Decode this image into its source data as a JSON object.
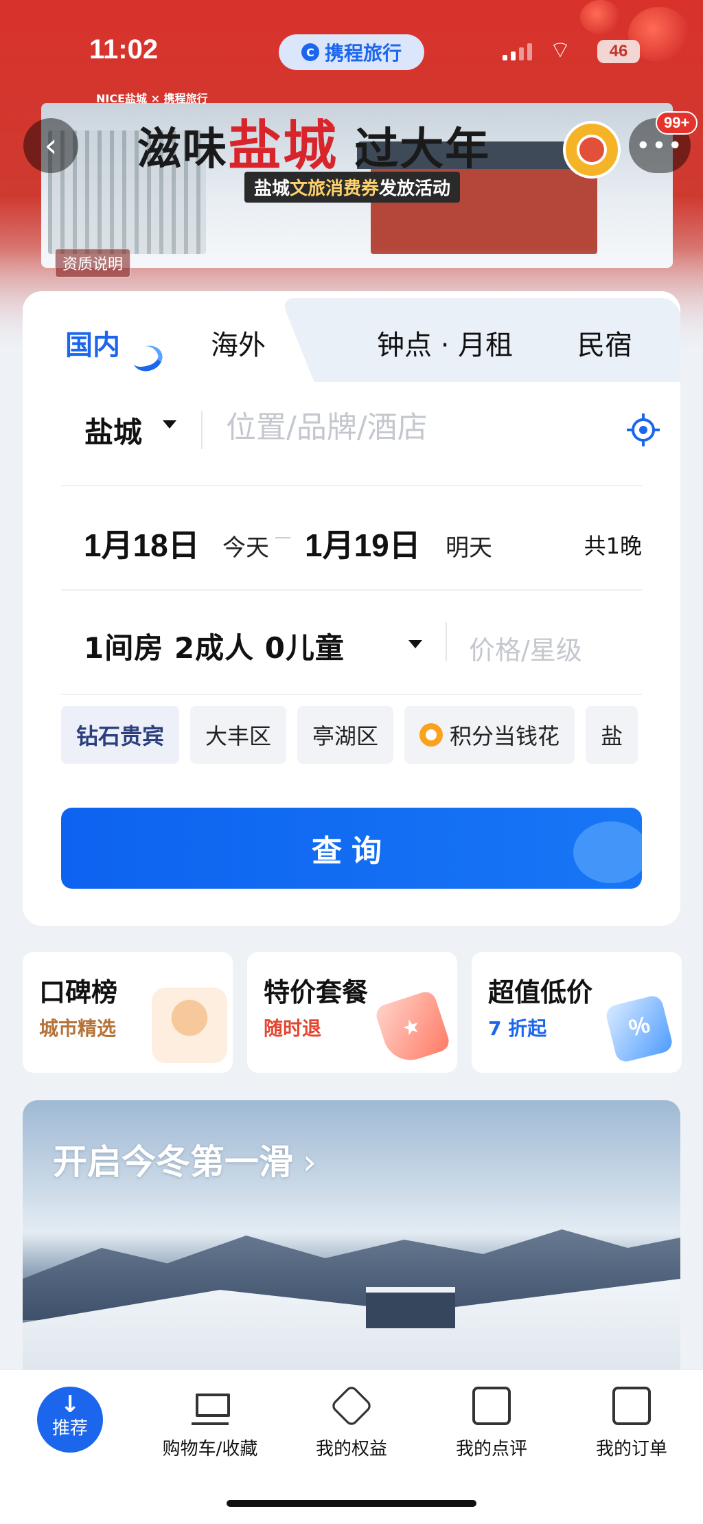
{
  "status_bar": {
    "time": "11:02",
    "app_badge": "携程旅行",
    "battery": "46"
  },
  "header": {
    "notification_count": "99+",
    "partner_logos": "NICE盐城 × 携程旅行",
    "banner_title_pre": "滋味",
    "banner_title_hl": "盐城",
    "banner_title_post": " 过大年",
    "banner_sub_pre": "盐城",
    "banner_sub_hl": "文旅消费券",
    "banner_sub_post": "发放活动",
    "qualification_link": "资质说明"
  },
  "tabs": [
    {
      "label": "国内",
      "active": true
    },
    {
      "label": "海外",
      "active": false
    },
    {
      "label": "钟点 · 月租",
      "active": false
    },
    {
      "label": "民宿",
      "active": false
    }
  ],
  "search": {
    "city": "盐城",
    "location_placeholder": "位置/品牌/酒店",
    "checkin_date": "1月18日",
    "checkin_day": "今天",
    "checkout_date": "1月19日",
    "checkout_day": "明天",
    "nights": "共1晚",
    "guests": "1间房  2成人  0儿童",
    "price_star": "价格/星级",
    "chips": [
      "钻石贵宾",
      "大丰区",
      "亭湖区",
      "积分当钱花",
      "盐"
    ],
    "button": "查询"
  },
  "promos": [
    {
      "title": "口碑榜",
      "subtitle": "城市精选"
    },
    {
      "title": "特价套餐",
      "subtitle": "随时退"
    },
    {
      "title": "超值低价",
      "subtitle": "7 折起"
    }
  ],
  "feature_banner": {
    "title": "开启今冬第一滑",
    "chevron": "›"
  },
  "bottom_nav": [
    {
      "label": "推荐",
      "icon": "arrow-down-icon",
      "active": true
    },
    {
      "label": "购物车/收藏",
      "icon": "cart-icon"
    },
    {
      "label": "我的权益",
      "icon": "diamond-icon"
    },
    {
      "label": "我的点评",
      "icon": "edit-icon"
    },
    {
      "label": "我的订单",
      "icon": "document-icon"
    }
  ],
  "colors": {
    "brand_blue": "#1C66EE",
    "banner_red": "#D8322B",
    "page_bg": "#EEF2F7"
  }
}
